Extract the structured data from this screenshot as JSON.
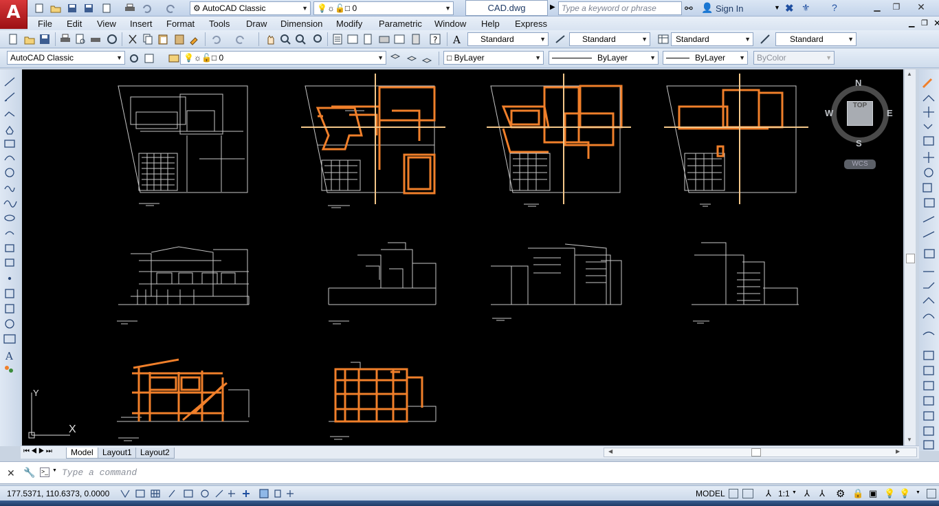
{
  "app": {
    "logo": "A",
    "workspace": "AutoCAD Classic",
    "layer_quick": "0",
    "file_title": "CAD.dwg",
    "search_placeholder": "Type a keyword or phrase",
    "sign_in": "Sign In"
  },
  "menu": [
    "File",
    "Edit",
    "View",
    "Insert",
    "Format",
    "Tools",
    "Draw",
    "Dimension",
    "Modify",
    "Parametric",
    "Window",
    "Help",
    "Express"
  ],
  "styles_toolbar": {
    "text_style": "Standard",
    "dim_style": "Standard",
    "table_style": "Standard",
    "mleader_style": "Standard"
  },
  "layers_toolbar": {
    "workspace": "AutoCAD Classic",
    "layer": "0",
    "color": "ByLayer",
    "linetype": "ByLayer",
    "lineweight": "ByLayer",
    "plot_style": "ByColor"
  },
  "viewcube": {
    "north": "N",
    "south": "S",
    "east": "E",
    "west": "W",
    "face": "TOP",
    "ucs": "WCS"
  },
  "ucs_icon": {
    "x": "X",
    "y": "Y"
  },
  "tabs": [
    "Model",
    "Layout1",
    "Layout2"
  ],
  "command": {
    "placeholder": "Type a command"
  },
  "status": {
    "coords": "177.5371, 110.6373, 0.0000",
    "space": "MODEL",
    "scale": "1:1"
  },
  "colors": {
    "highlight": "#f07f2a",
    "drawing_bg": "#000000",
    "ribbon": "#dbe6f4"
  },
  "icons": [
    "new-icon",
    "open-icon",
    "save-icon",
    "saveas-icon",
    "plot-icon",
    "undo-icon",
    "redo-icon",
    "gear-icon",
    "lightbulb-icon",
    "binoculars-icon",
    "user-icon",
    "help-icon",
    "close-icon"
  ]
}
